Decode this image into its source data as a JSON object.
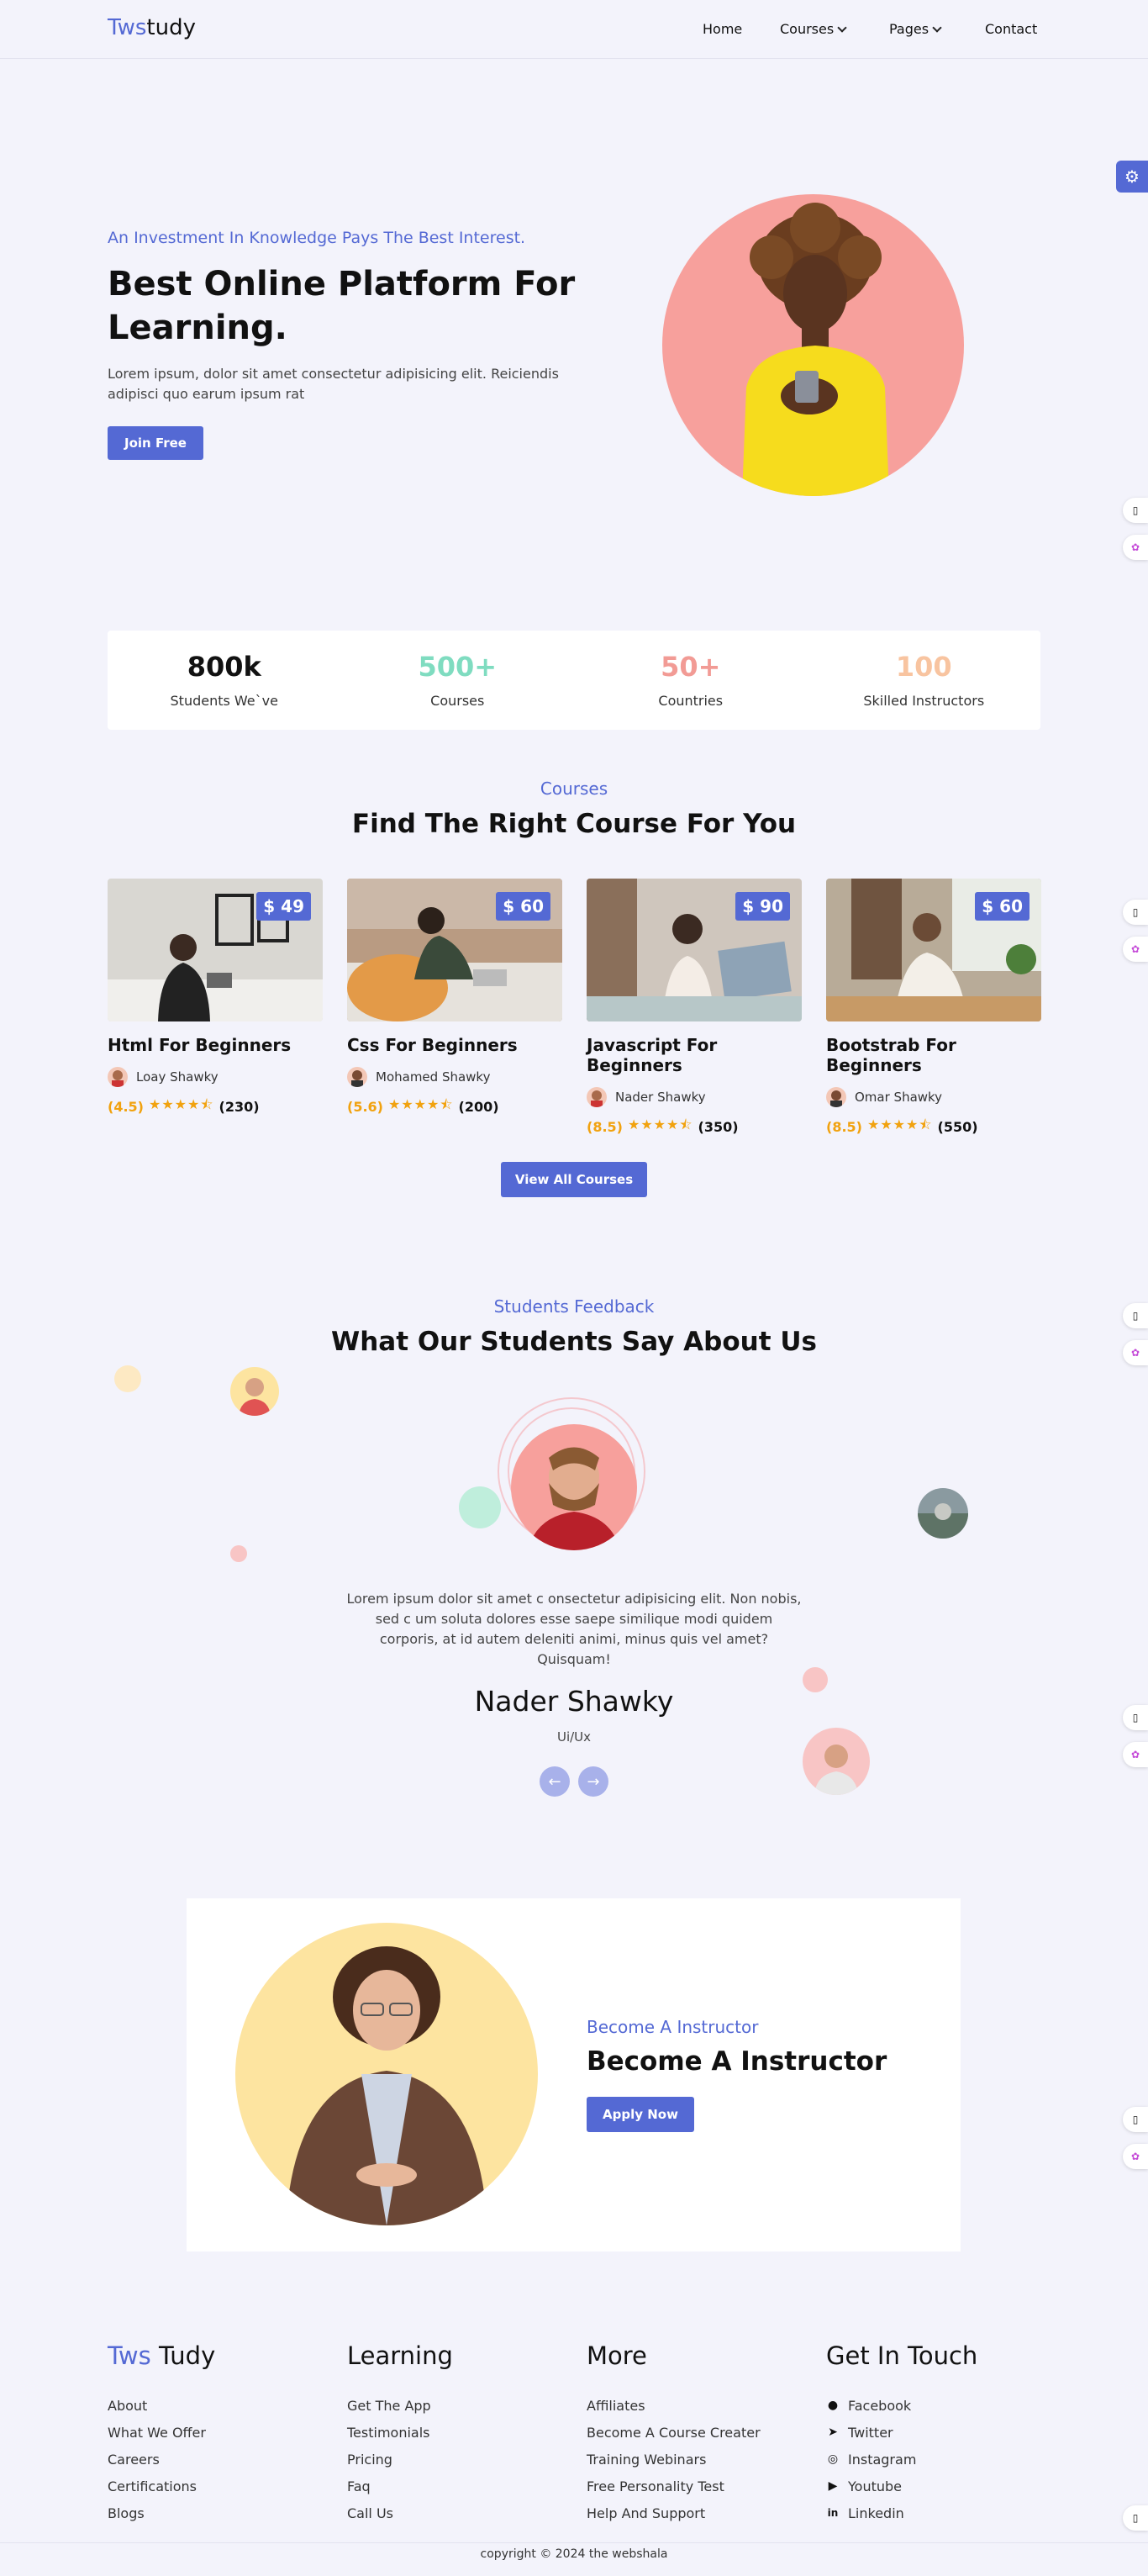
{
  "nav": {
    "logo_accent": "Tws",
    "logo_rest": "tudy",
    "items": [
      {
        "label": "Home"
      },
      {
        "label": "Courses"
      },
      {
        "label": "Pages"
      },
      {
        "label": "Contact"
      }
    ]
  },
  "hero": {
    "tagline": "An Investment In Knowledge Pays The Best Interest.",
    "title": "Best Online Platform For Learning.",
    "text": "Lorem ipsum, dolor sit amet consectetur adipisicing elit. Reiciendis adipisci quo earum ipsum rat",
    "button": "Join Free"
  },
  "stats": [
    {
      "value": "800k",
      "label": "Students We`ve",
      "color": "#111111"
    },
    {
      "value": "500+",
      "label": "Courses",
      "color": "#7fdcc0"
    },
    {
      "value": "50+",
      "label": "Countries",
      "color": "#f29b95"
    },
    {
      "value": "100",
      "label": "Skilled Instructors",
      "color": "#f8c4a0"
    }
  ],
  "courses_section": {
    "tag": "Courses",
    "title": "Find The Right Course For You",
    "button": "View All Courses",
    "courses": [
      {
        "price": "$ 49",
        "title": "Html For Beginners",
        "author": "Loay Shawky",
        "score": "(4.5)",
        "stars": "★★★★⯪",
        "count": "(230)"
      },
      {
        "price": "$ 60",
        "title": "Css For Beginners",
        "author": "Mohamed Shawky",
        "score": "(5.6)",
        "stars": "★★★★⯪",
        "count": "(200)"
      },
      {
        "price": "$ 90",
        "title": "Javascript For Beginners",
        "author": "Nader Shawky",
        "score": "(8.5)",
        "stars": "★★★★⯪",
        "count": "(350)"
      },
      {
        "price": "$ 60",
        "title": "Bootstrab For Beginners",
        "author": "Omar Shawky",
        "score": "(8.5)",
        "stars": "★★★★⯪",
        "count": "(550)"
      }
    ]
  },
  "feedback": {
    "tag": "Students Feedback",
    "title": "What Our Students Say About Us",
    "text": "Lorem ipsum dolor sit amet c onsectetur adipisicing elit. Non nobis, sed c um soluta dolores esse saepe similique modi quidem corporis, at id autem deleniti animi, minus quis vel amet? Quisquam!",
    "name": "Nader Shawky",
    "role": "Ui/Ux",
    "prev_icon": "arrow-left-icon",
    "next_icon": "arrow-right-icon"
  },
  "instructor": {
    "tag": "Become A Instructor",
    "title": "Become A Instructor",
    "button": "Apply Now"
  },
  "footer": {
    "brand_accent": "Tws",
    "brand_rest": " Tudy",
    "brand_links": [
      "About",
      "What We Offer",
      "Careers",
      "Certifications",
      "Blogs"
    ],
    "learning_title": "Learning",
    "learning_links": [
      "Get The App",
      "Testimonials",
      "Pricing",
      "Faq",
      "Call Us"
    ],
    "more_title": "More",
    "more_links": [
      "Affiliates",
      "Become A Course Creater",
      "Training Webinars",
      "Free Personality Test",
      "Help And Support"
    ],
    "contact_title": "Get In Touch",
    "contact_links": [
      {
        "icon": "facebook-icon",
        "label": "Facebook"
      },
      {
        "icon": "twitter-icon",
        "label": "Twitter"
      },
      {
        "icon": "instagram-icon",
        "label": "Instagram"
      },
      {
        "icon": "youtube-icon",
        "label": "Youtube"
      },
      {
        "icon": "linkedin-icon",
        "label": "Linkedin"
      }
    ],
    "copyright": "copyright © 2024 the webshala"
  },
  "colors": {
    "accent": "#5469d4",
    "background": "#f3f3fb",
    "star": "#f1a20f"
  }
}
